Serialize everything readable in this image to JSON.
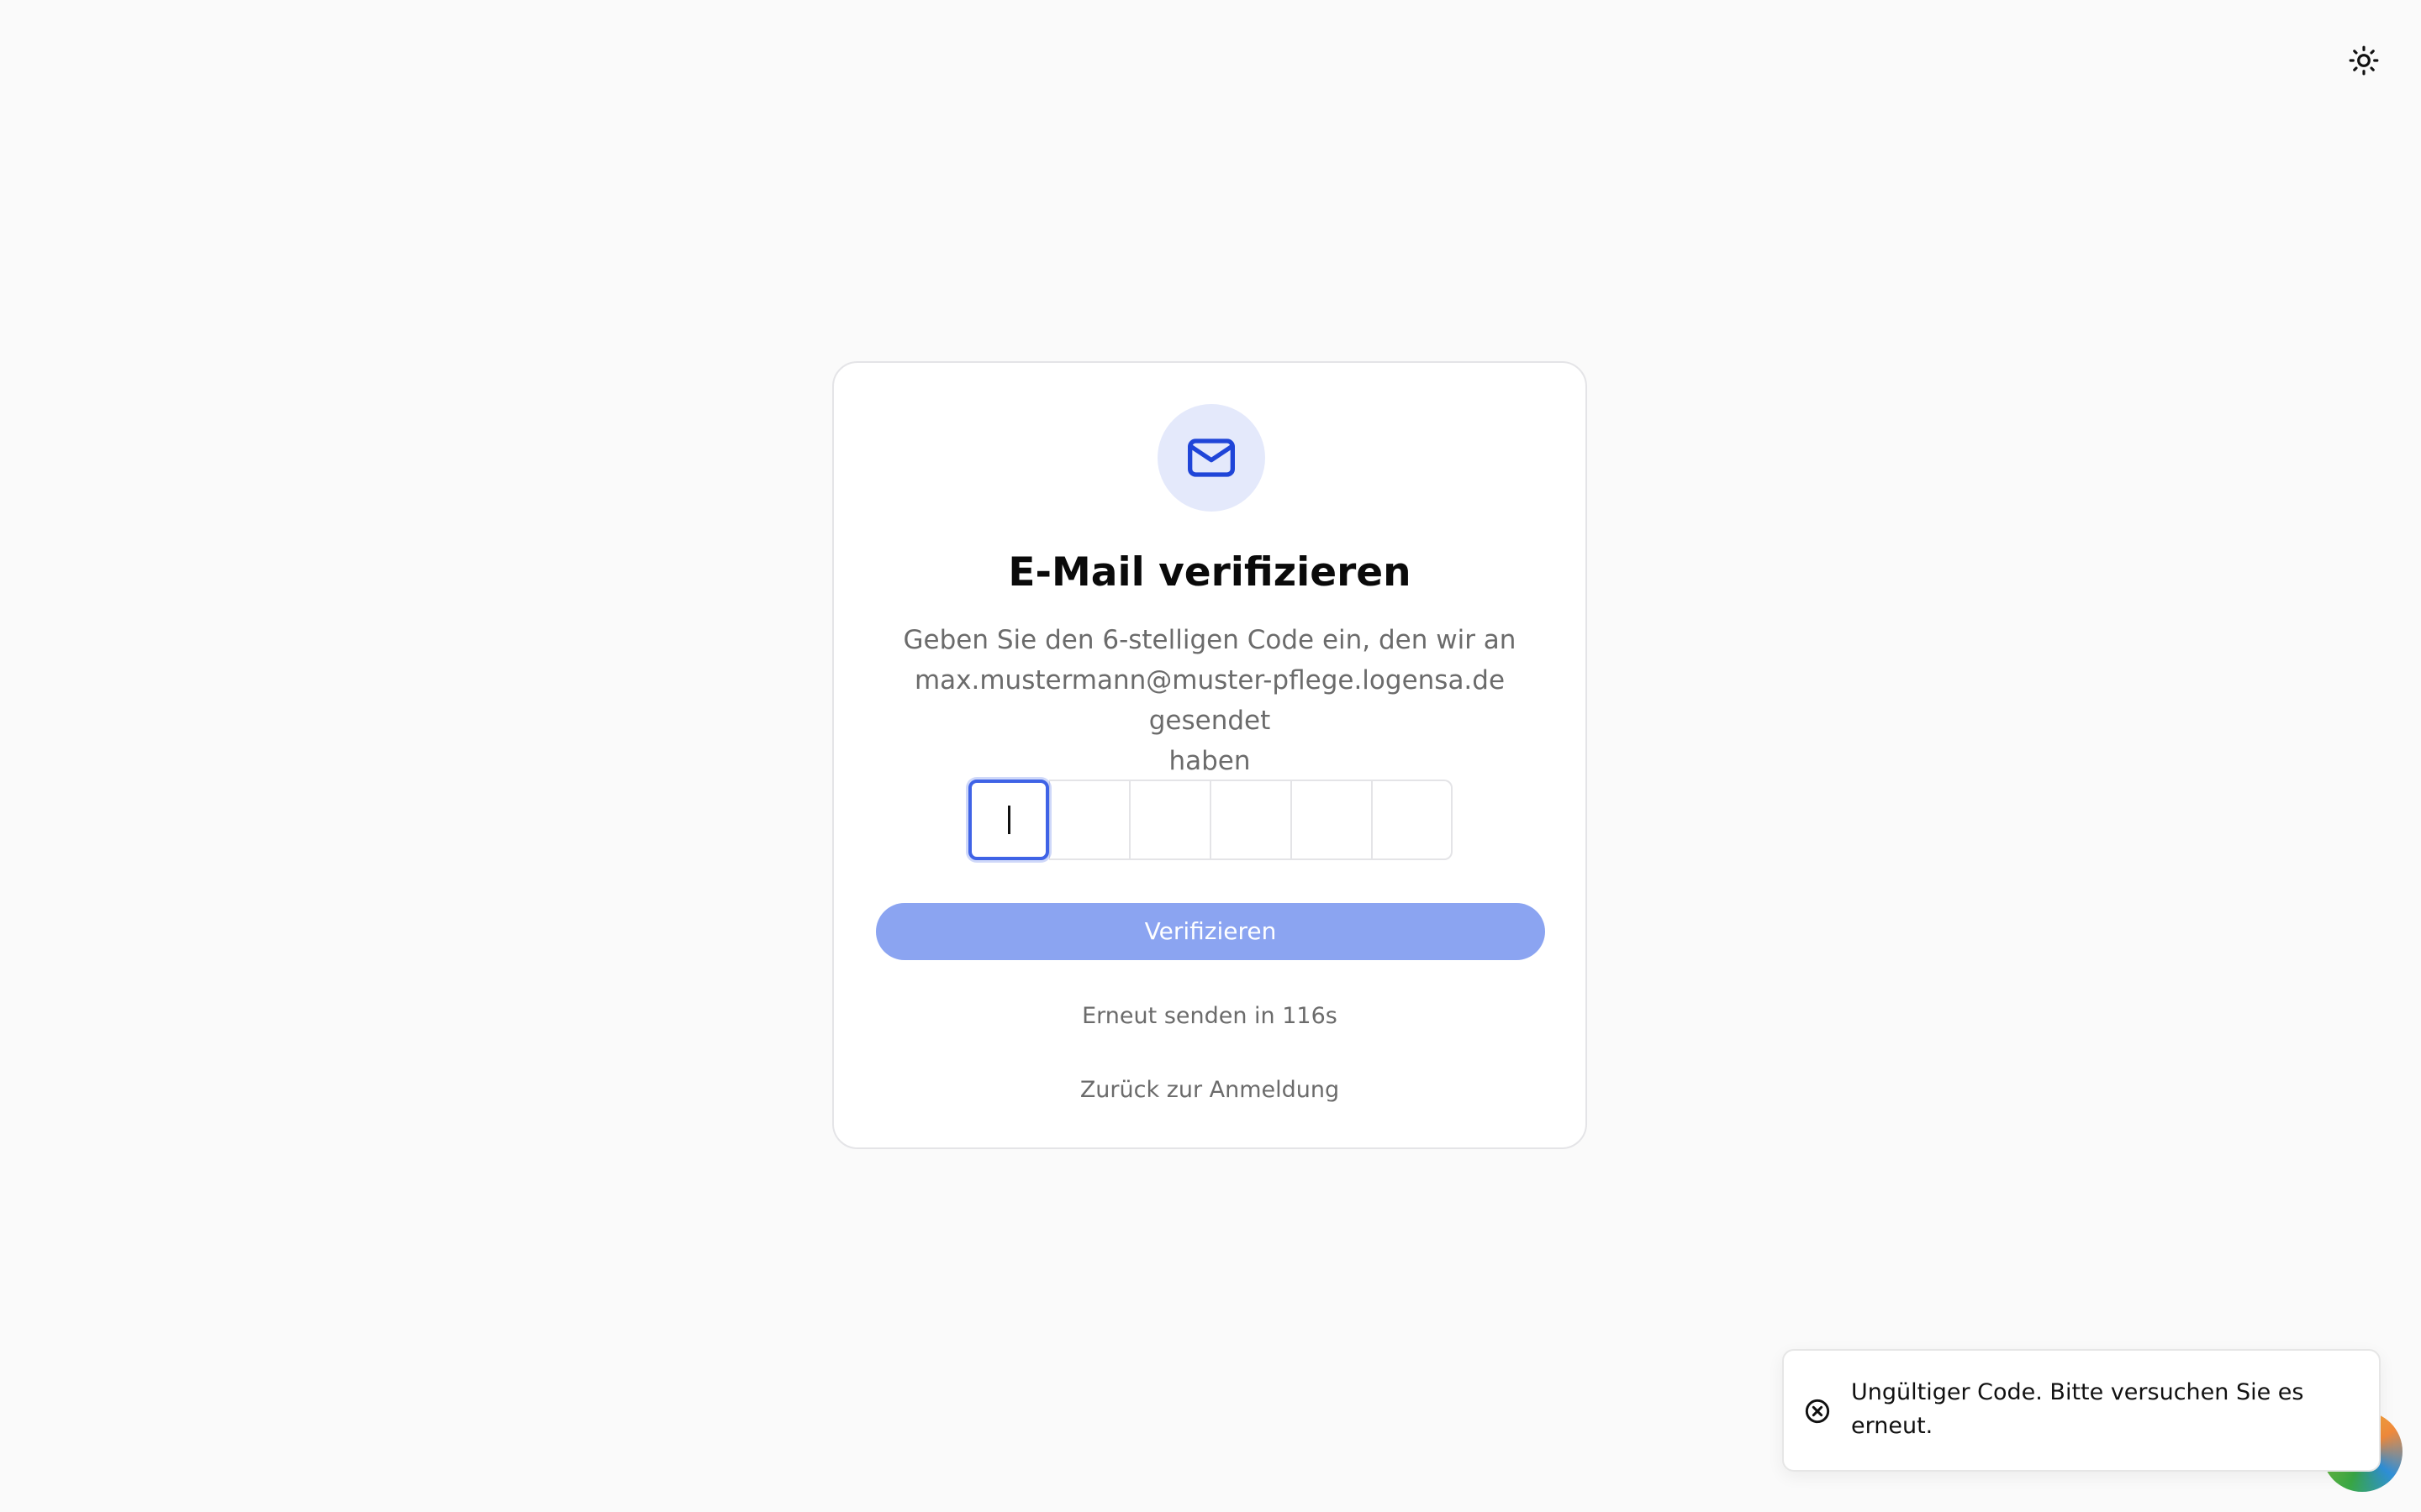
{
  "header": {
    "theme_toggle_icon": "sun-icon"
  },
  "card": {
    "icon": "mail-icon",
    "title": "E-Mail verifizieren",
    "description_line1": "Geben Sie den 6-stelligen Code ein, den wir an",
    "description_line2": "max.mustermann@muster-pflege.logensa.de gesendet",
    "description_line3": "haben",
    "otp_length": 6,
    "otp_digits": [
      "",
      "",
      "",
      "",
      "",
      ""
    ],
    "verify_button_label": "Verifizieren",
    "resend_label": "Erneut senden in 116s",
    "back_link_label": "Zurück zur Anmeldung"
  },
  "toast": {
    "icon": "error-circle-icon",
    "message": "Ungültiger Code. Bitte versuchen Sie es erneut."
  },
  "colors": {
    "background": "#fafafa",
    "accent": "#3f63e6",
    "button_disabled": "#8ba4f1",
    "icon_circle": "#e4e9fb",
    "muted_text": "#6b6b6b"
  }
}
